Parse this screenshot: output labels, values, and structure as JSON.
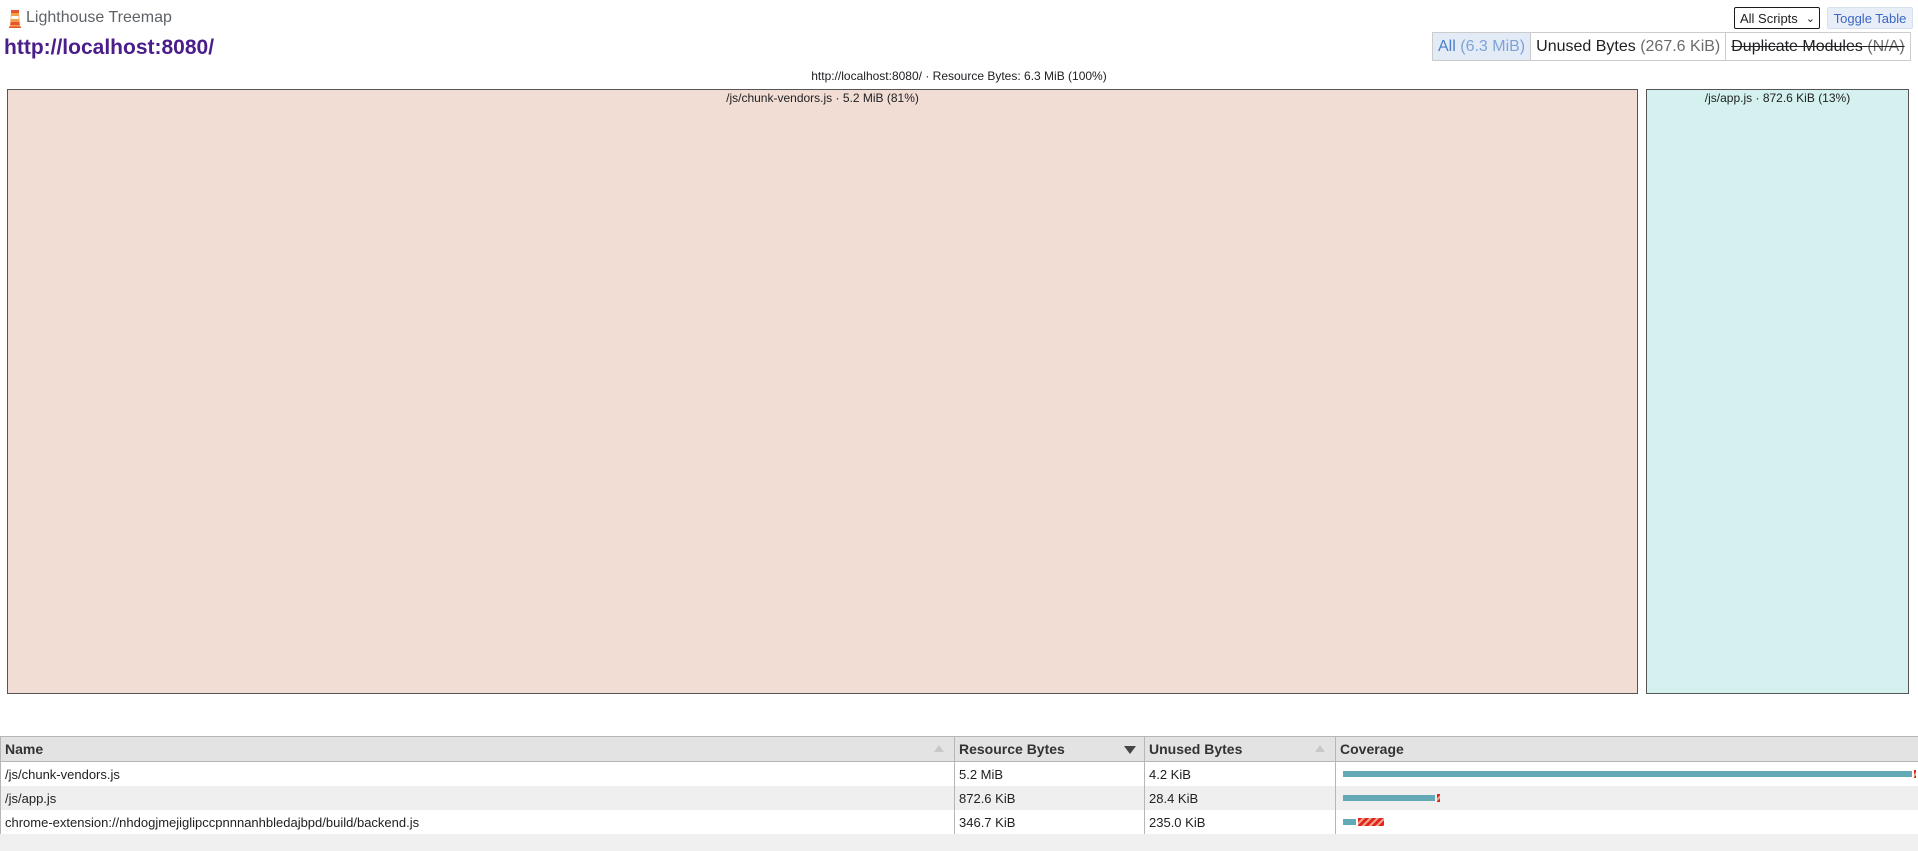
{
  "app": {
    "title": "Lighthouse Treemap",
    "url": "http://localhost:8080/"
  },
  "controls": {
    "scripts_select": "All Scripts",
    "toggle_table": "Toggle Table"
  },
  "modes": [
    {
      "label": "All",
      "value": "(6.3 MiB)",
      "state": "active"
    },
    {
      "label": "Unused Bytes",
      "value": "(267.6 KiB)",
      "state": "normal"
    },
    {
      "label": "Duplicate Modules",
      "value": "(N/A)",
      "state": "disabled"
    }
  ],
  "treemap": {
    "header": "http://localhost:8080/ · Resource Bytes: 6.3 MiB (100%)",
    "nodes": [
      {
        "label": "/js/chunk-vendors.js · 5.2 MiB (81%)",
        "color": "#f2ddd5"
      },
      {
        "label": "/js/app.js · 872.6 KiB (13%)",
        "color": "#d4f1ef"
      }
    ]
  },
  "table": {
    "columns": [
      "Name",
      "Resource Bytes",
      "Unused Bytes",
      "Coverage"
    ],
    "rows": [
      {
        "name": "/js/chunk-vendors.js",
        "resource": "5.2 MiB",
        "unused": "4.2 KiB",
        "coverage_used": 0.999,
        "coverage_unused": 0.001
      },
      {
        "name": "/js/app.js",
        "resource": "872.6 KiB",
        "unused": "28.4 KiB",
        "coverage_used": 0.161,
        "coverage_unused": 0.005
      },
      {
        "name": "chrome-extension://nhdogjmejiglipccpnnnanhbledajbpd/build/backend.js",
        "resource": "346.7 KiB",
        "unused": "235.0 KiB",
        "coverage_used": 0.022,
        "coverage_unused": 0.046
      }
    ]
  },
  "colors": {
    "used": "#64a9b6",
    "unused": "#e0251a",
    "url_title": "#4b1d8a",
    "active_mode": "#4a7fc8"
  }
}
